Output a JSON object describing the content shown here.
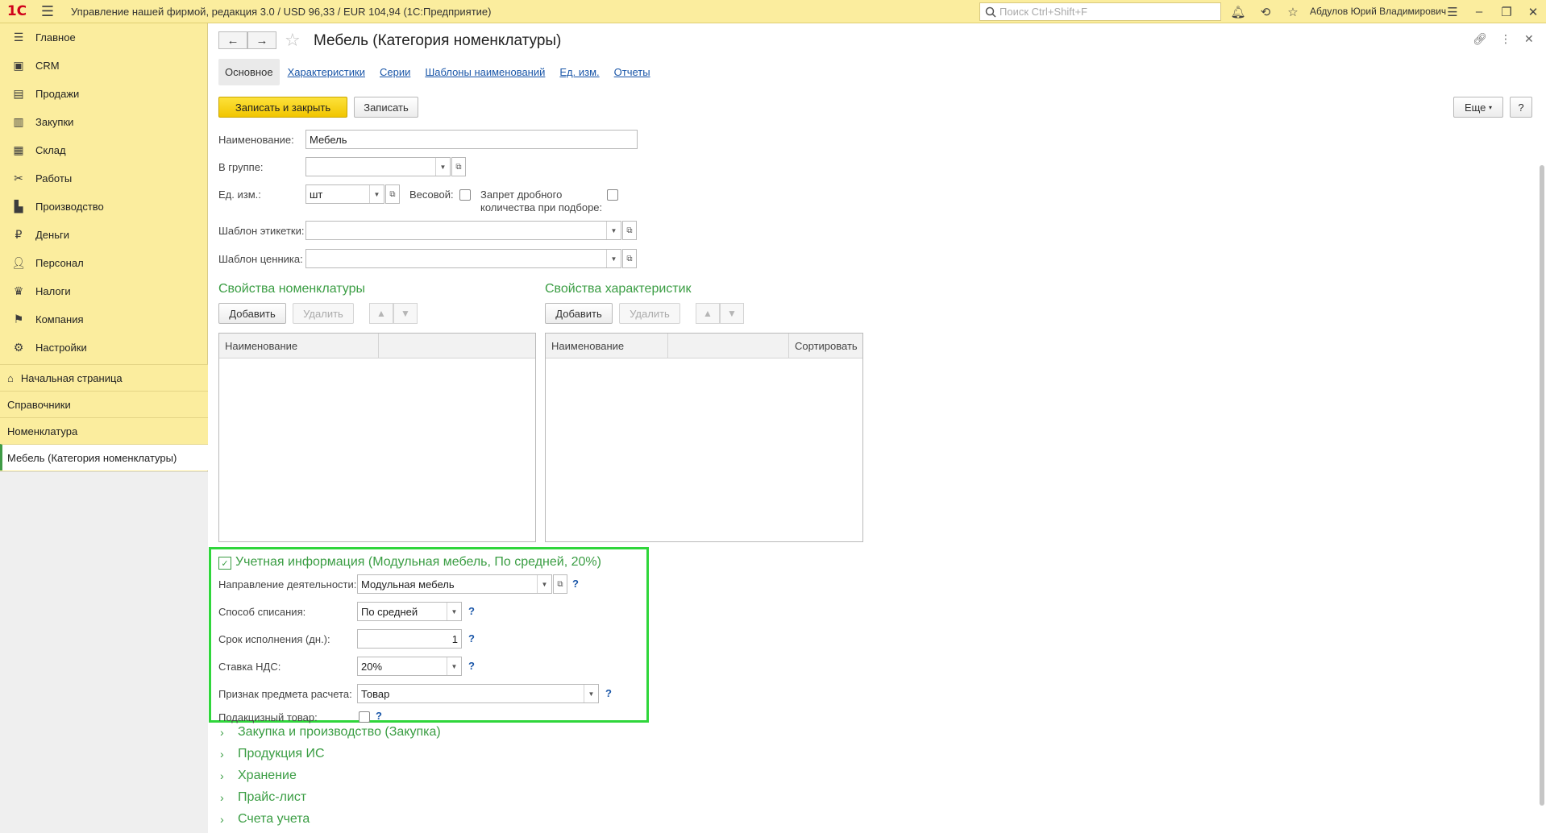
{
  "titlebar": {
    "logo": "1С",
    "app_title": "Управление нашей фирмой, редакция 3.0 / USD 96,33 / EUR 104,94  (1С:Предприятие)",
    "search_placeholder": "Поиск Ctrl+Shift+F",
    "user": "Абдулов Юрий Владимирович"
  },
  "sidebar": {
    "sections": [
      {
        "label": "Главное",
        "icon": "menu-lines-icon"
      },
      {
        "label": "CRM",
        "icon": "crm-icon"
      },
      {
        "label": "Продажи",
        "icon": "basket-icon"
      },
      {
        "label": "Закупки",
        "icon": "purchases-icon"
      },
      {
        "label": "Склад",
        "icon": "warehouse-icon"
      },
      {
        "label": "Работы",
        "icon": "tools-icon"
      },
      {
        "label": "Производство",
        "icon": "factory-icon"
      },
      {
        "label": "Деньги",
        "icon": "ruble-icon"
      },
      {
        "label": "Персонал",
        "icon": "people-icon"
      },
      {
        "label": "Налоги",
        "icon": "eagle-icon"
      },
      {
        "label": "Компания",
        "icon": "flag-icon"
      },
      {
        "label": "Настройки",
        "icon": "gear-icon"
      }
    ],
    "open_windows": [
      {
        "label": "Начальная страница",
        "icon": "home-icon"
      },
      {
        "label": "Справочники"
      },
      {
        "label": "Номенклатура"
      },
      {
        "label": "Мебель (Категория номенклатуры)",
        "active": true
      }
    ]
  },
  "form": {
    "title": "Мебель (Категория номенклатуры)",
    "tabs": [
      "Основное",
      "Характеристики",
      "Серии",
      "Шаблоны наименований",
      "Ед. изм.",
      "Отчеты"
    ],
    "buttons": {
      "save_close": "Записать и закрыть",
      "save": "Записать",
      "more": "Еще",
      "help": "?"
    },
    "fields": {
      "name_label": "Наименование:",
      "name_value": "Мебель",
      "group_label": "В группе:",
      "group_value": "",
      "unit_label": "Ед. изм.:",
      "unit_value": "шт",
      "weight_label": "Весовой:",
      "fraction_label_1": "Запрет дробного",
      "fraction_label_2": "количества при подборе:",
      "label_template_label": "Шаблон этикетки:",
      "label_template_value": "",
      "price_template_label": "Шаблон ценника:",
      "price_template_value": ""
    },
    "props_nom": {
      "title": "Свойства номенклатуры",
      "add": "Добавить",
      "delete": "Удалить",
      "columns": [
        "Наименование",
        ""
      ]
    },
    "props_char": {
      "title": "Свойства характеристик",
      "add": "Добавить",
      "delete": "Удалить",
      "columns": [
        "Наименование",
        "",
        "Сортировать"
      ]
    },
    "accounting": {
      "header": "Учетная информация (Модульная мебель, По средней, 20%)",
      "direction_label": "Направление деятельности:",
      "direction_value": "Модульная мебель",
      "writeoff_label": "Способ списания:",
      "writeoff_value": "По средней",
      "term_label": "Срок исполнения (дн.):",
      "term_value": "1",
      "vat_label": "Ставка НДС:",
      "vat_value": "20%",
      "subject_label": "Признак предмета расчета:",
      "subject_value": "Товар",
      "excise_label": "Подакцизный товар:"
    },
    "collapsed_groups": [
      "Закупка и производство (Закупка)",
      "Продукция ИС",
      "Хранение",
      "Прайс-лист",
      "Счета учета"
    ]
  }
}
